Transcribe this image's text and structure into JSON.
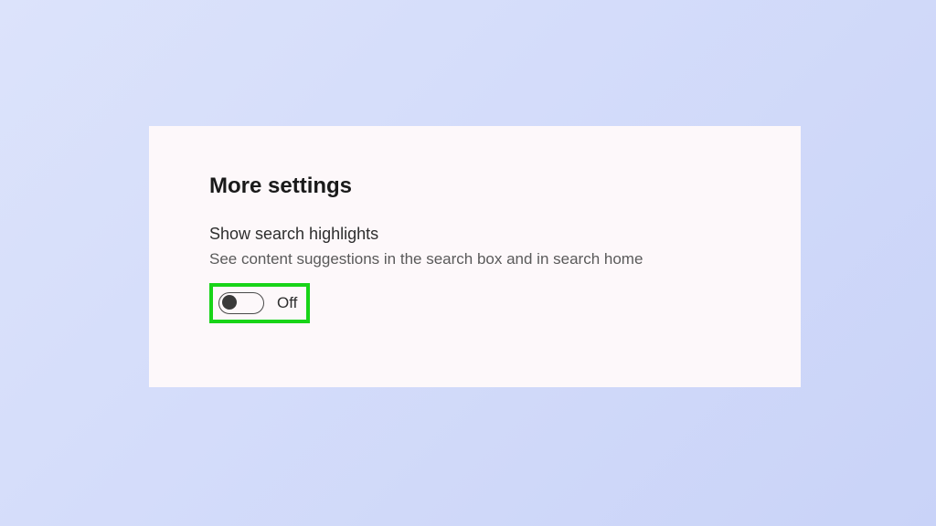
{
  "section": {
    "heading": "More settings"
  },
  "setting": {
    "label": "Show search highlights",
    "description": "See content suggestions in the search box and in search home",
    "toggle_state": "Off"
  },
  "highlight": {
    "color": "#18d418"
  }
}
